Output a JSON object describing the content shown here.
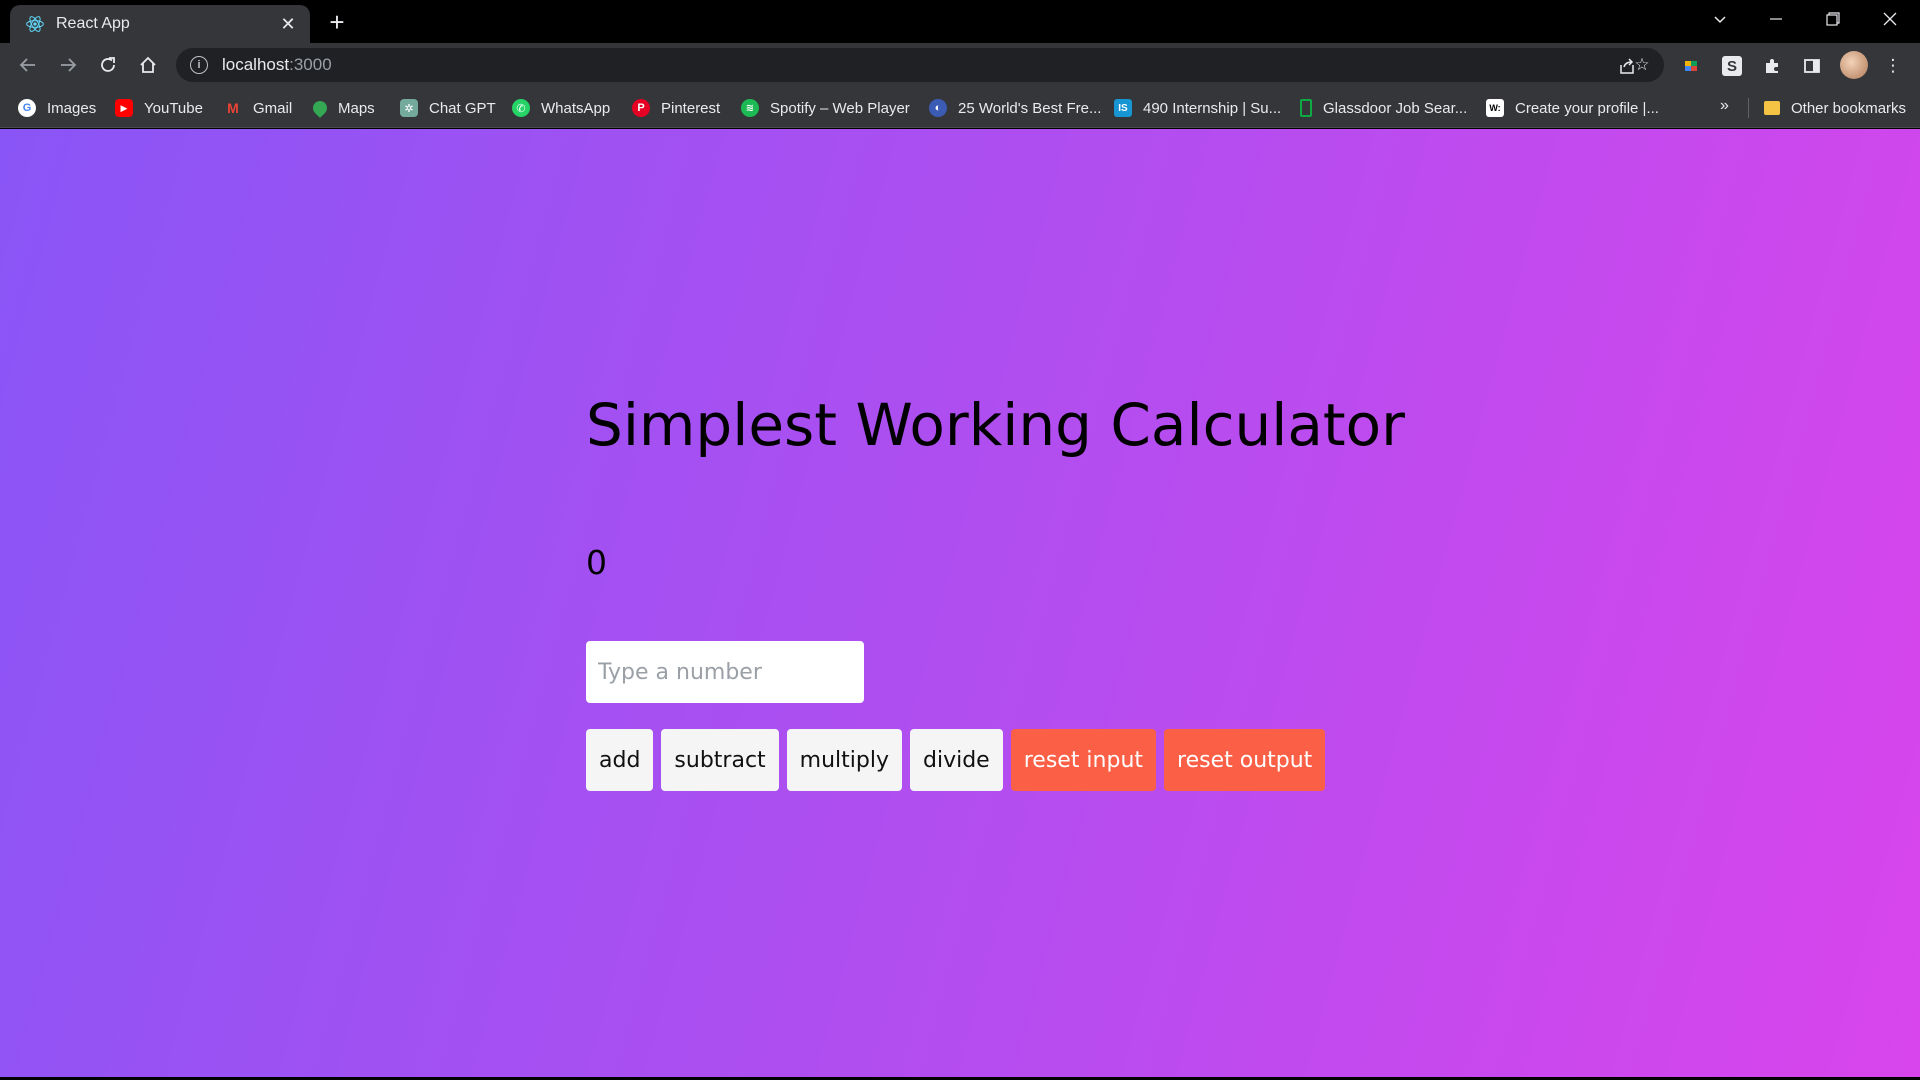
{
  "browser": {
    "tab": {
      "title": "React App",
      "favicon": "react-icon"
    },
    "url": {
      "host": "localhost",
      "port": ":3000"
    },
    "bookmarks": [
      {
        "label": "Images",
        "icon": "google-icon",
        "color": "#4285f4"
      },
      {
        "label": "YouTube",
        "icon": "youtube-icon",
        "color": "#ff0000"
      },
      {
        "label": "Gmail",
        "icon": "gmail-icon",
        "color": "#ea4335"
      },
      {
        "label": "Maps",
        "icon": "maps-icon",
        "color": "#34a853"
      },
      {
        "label": "Chat GPT",
        "icon": "chatgpt-icon",
        "color": "#74aa9c"
      },
      {
        "label": "WhatsApp",
        "icon": "whatsapp-icon",
        "color": "#25d366"
      },
      {
        "label": "Pinterest",
        "icon": "pinterest-icon",
        "color": "#e60023"
      },
      {
        "label": "Spotify – Web Player",
        "icon": "spotify-icon",
        "color": "#1db954"
      },
      {
        "label": "25 World's Best Fre...",
        "icon": "globe-icon",
        "color": "#3b5bb5"
      },
      {
        "label": "490 Internship | Su...",
        "icon": "internshala-icon",
        "color": "#1895d3"
      },
      {
        "label": "Glassdoor Job Sear...",
        "icon": "glassdoor-icon",
        "color": "#0caa41"
      },
      {
        "label": "Create your profile |...",
        "icon": "wellfound-icon",
        "color": "#ffffff"
      }
    ],
    "other_bookmarks": "Other bookmarks"
  },
  "app": {
    "title": "Simplest Working Calculator",
    "result": "0",
    "input": {
      "placeholder": "Type a number",
      "value": ""
    },
    "buttons": {
      "add": "add",
      "subtract": "subtract",
      "multiply": "multiply",
      "divide": "divide",
      "reset_input": "reset input",
      "reset_output": "reset output"
    },
    "colors": {
      "gradient_start": "#8a55f6",
      "gradient_end": "#d845ec",
      "reset_button": "#fb5f46"
    }
  }
}
